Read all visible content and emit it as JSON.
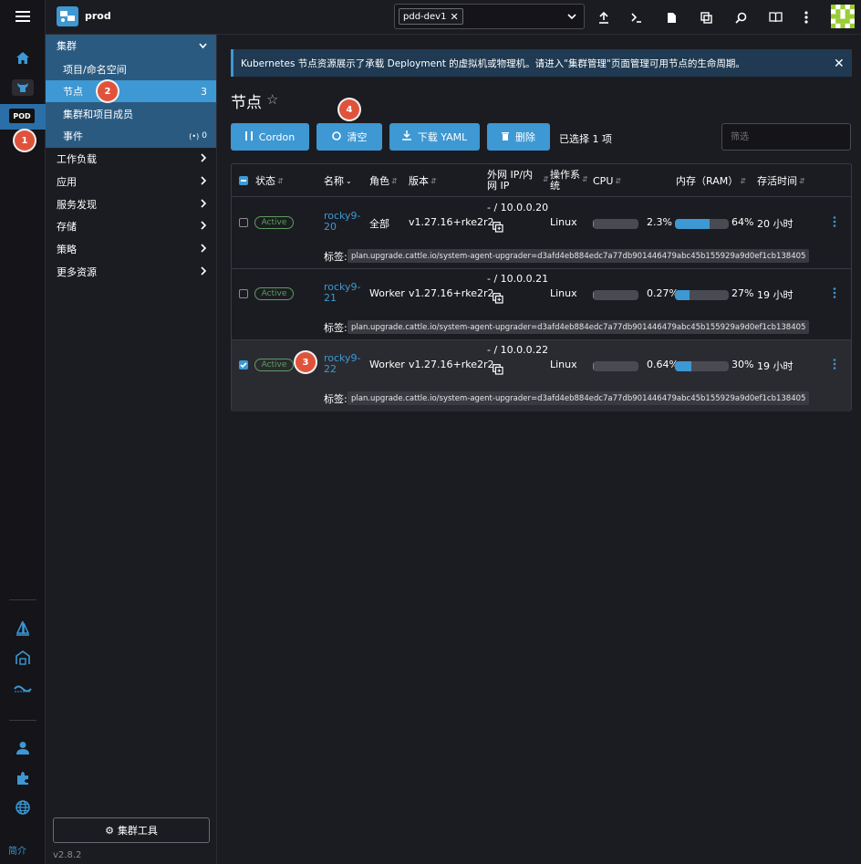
{
  "header": {
    "cluster_name": "prod",
    "filter_chip": "pdd-dev1",
    "brand_color": "#3d98d3"
  },
  "rail": {
    "pod_label": "POD",
    "about_label": "简介"
  },
  "sidenav": {
    "cluster_group": "集群",
    "items": [
      {
        "label": "项目/命名空间",
        "count": ""
      },
      {
        "label": "节点",
        "count": "3"
      },
      {
        "label": "集群和项目成员",
        "count": ""
      },
      {
        "label": "事件",
        "count": "0"
      }
    ],
    "groups": [
      "工作负载",
      "应用",
      "服务发现",
      "存储",
      "策略",
      "更多资源"
    ],
    "tools_button": "集群工具",
    "version": "v2.8.2"
  },
  "banner": {
    "text": "Kubernetes 节点资源展示了承载 Deployment 的虚拟机或物理机。请进入\"集群管理\"页面管理可用节点的生命周期。"
  },
  "page": {
    "title": "节点",
    "buttons": {
      "cordon": "Cordon",
      "clear": "清空",
      "download": "下载 YAML",
      "delete": "删除"
    },
    "selected_text": "已选择 1 项",
    "filter_placeholder": "筛选"
  },
  "markers": [
    "1",
    "2",
    "3",
    "4"
  ],
  "table": {
    "headers": {
      "status": "状态",
      "name": "名称",
      "role": "角色",
      "version": "版本",
      "ip_line1": "外网 IP/内",
      "ip_line2": "网 IP",
      "os_line1": "操作系",
      "os_line2": "统",
      "cpu": "CPU",
      "ram": "内存（RAM）",
      "age": "存活时间"
    },
    "label_prefix": "标签:",
    "rows": [
      {
        "status": "Active",
        "name_line1": "rocky9-",
        "name_line2": "20",
        "role": "全部",
        "version": "v1.27.16+rke2r2",
        "ip": "- / 10.0.0.20",
        "os": "Linux",
        "cpu_text": "2.3%",
        "cpu_value": 2.3,
        "ram_text": "64%",
        "ram_value": 64,
        "age": "20 小时",
        "label": "plan.upgrade.cattle.io/system-agent-upgrader=d3afd4eb884edc7a77db901446479abc45b155929a9d0ef1cb138405",
        "selected": false
      },
      {
        "status": "Active",
        "name_line1": "rocky9-",
        "name_line2": "21",
        "role": "Worker",
        "version": "v1.27.16+rke2r2",
        "ip": "- / 10.0.0.21",
        "os": "Linux",
        "cpu_text": "0.27%",
        "cpu_value": 0.27,
        "ram_text": "27%",
        "ram_value": 27,
        "age": "19 小时",
        "label": "plan.upgrade.cattle.io/system-agent-upgrader=d3afd4eb884edc7a77db901446479abc45b155929a9d0ef1cb138405",
        "selected": false
      },
      {
        "status": "Active",
        "name_line1": "rocky9-",
        "name_line2": "22",
        "role": "Worker",
        "version": "v1.27.16+rke2r2",
        "ip": "- / 10.0.0.22",
        "os": "Linux",
        "cpu_text": "0.64%",
        "cpu_value": 0.64,
        "ram_text": "30%",
        "ram_value": 30,
        "age": "19 小时",
        "label": "plan.upgrade.cattle.io/system-agent-upgrader=d3afd4eb884edc7a77db901446479abc45b155929a9d0ef1cb138405",
        "selected": true
      }
    ]
  }
}
